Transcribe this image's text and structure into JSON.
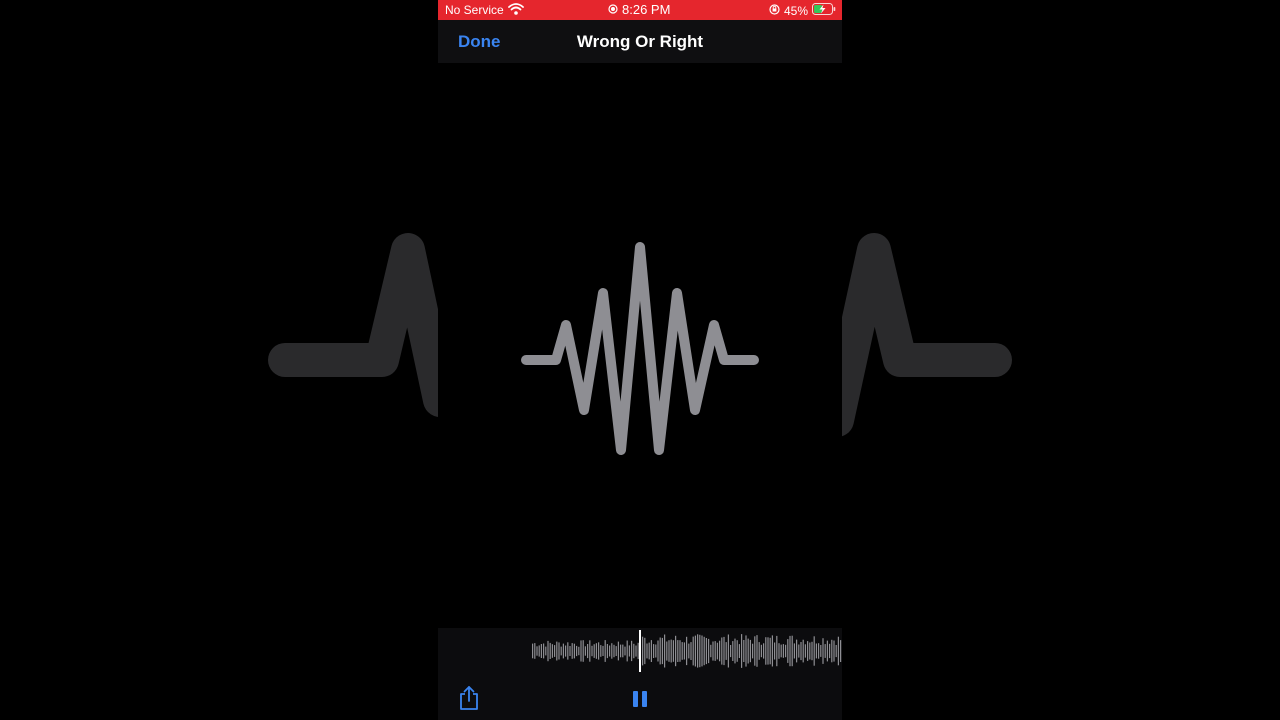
{
  "status_bar": {
    "carrier": "No Service",
    "time": "8:26 PM",
    "battery": "45%",
    "background_color": "#e5262d",
    "icons": [
      "wifi-icon",
      "screen-record-icon",
      "orientation-lock-icon",
      "battery-charging-icon"
    ]
  },
  "nav": {
    "done_label": "Done",
    "title": "Wrong Or Right"
  },
  "artwork": {
    "icon": "soundwave-icon",
    "color": "#8e8e93"
  },
  "player": {
    "state": "playing",
    "controls": [
      "share-icon",
      "pause-icon"
    ],
    "accent_color": "#3a84f0"
  }
}
